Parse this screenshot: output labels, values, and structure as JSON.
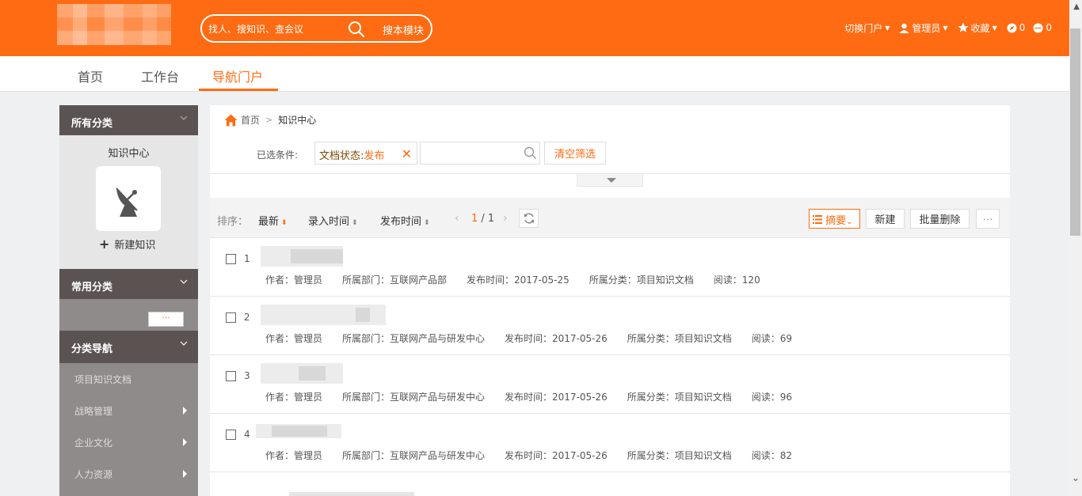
{
  "header": {
    "search_placeholder": "找人、搜知识、查会议",
    "search_scope": "搜本模块",
    "switch_portal": "切换门户",
    "user": "管理员",
    "favorites": "收藏",
    "count_a": "0",
    "count_b": "0"
  },
  "tabs": [
    "首页",
    "工作台",
    "导航门户"
  ],
  "sidebar": {
    "all_categories": "所有分类",
    "knowledge_center": "知识中心",
    "new_knowledge": "新建知识",
    "common_categories": "常用分类",
    "more": "···",
    "category_nav": "分类导航",
    "nav_items": [
      "项目知识文档",
      "战略管理",
      "企业文化",
      "人力资源"
    ]
  },
  "breadcrumb": {
    "home": "首页",
    "current": "知识中心"
  },
  "filters": {
    "label": "已选条件:",
    "tag_key": "文档状态:",
    "tag_value": "发布",
    "clear": "清空筛选"
  },
  "toolbar": {
    "sort_label": "排序：",
    "sort_latest": "最新",
    "sort_entry_time": "录入时间",
    "sort_publish_time": "发布时间",
    "page_current": "1",
    "page_total": "/ 1",
    "view_mode": "摘要",
    "new": "新建",
    "batch_delete": "批量删除",
    "more": "···"
  },
  "rows": [
    {
      "index": "1",
      "author": "作者：管理员",
      "dept": "所属部门：互联网产品部",
      "date": "发布时间：2017-05-25",
      "category": "所属分类：项目知识文档",
      "reads": "阅读：120"
    },
    {
      "index": "2",
      "author": "作者：管理员",
      "dept": "所属部门：互联网产品与研发中心",
      "date": "发布时间：2017-05-26",
      "category": "所属分类：项目知识文档",
      "reads": "阅读：69"
    },
    {
      "index": "3",
      "author": "作者：管理员",
      "dept": "所属部门：互联网产品与研发中心",
      "date": "发布时间：2017-05-26",
      "category": "所属分类：项目知识文档",
      "reads": "阅读：96"
    },
    {
      "index": "4",
      "author": "作者：管理员",
      "dept": "所属部门：互联网产品与研发中心",
      "date": "发布时间：2017-05-26",
      "category": "所属分类：项目知识文档",
      "reads": "阅读：82"
    }
  ]
}
